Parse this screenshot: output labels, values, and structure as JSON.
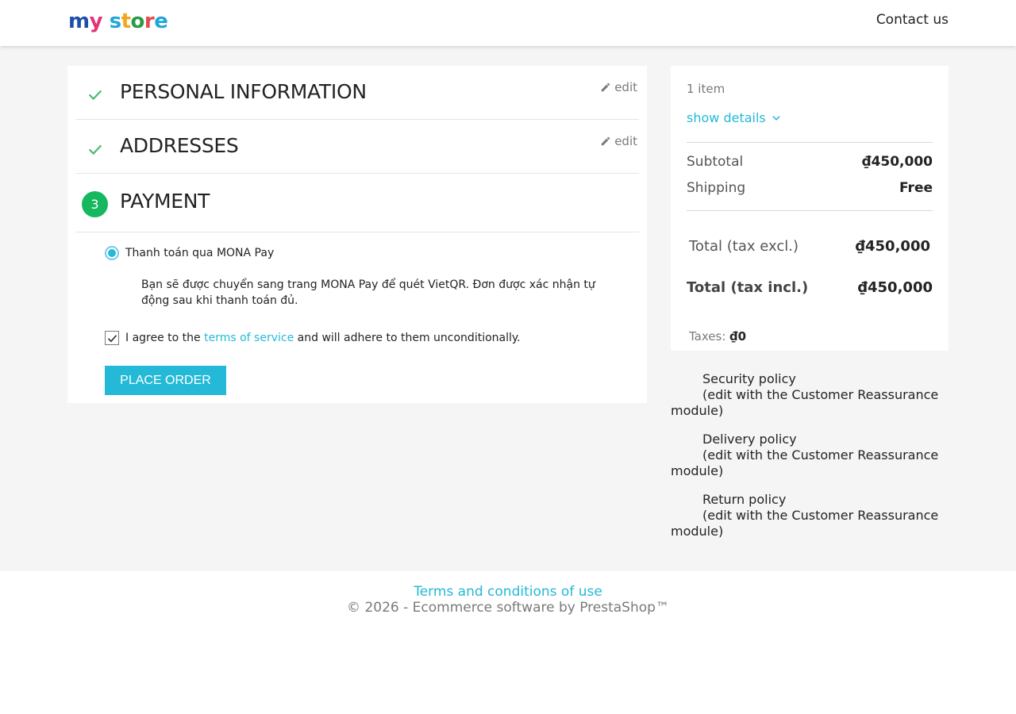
{
  "header": {
    "logo_parts": [
      "m",
      "y",
      " s",
      "t",
      "o",
      "r",
      "e"
    ],
    "contact_label": "Contact us"
  },
  "checkout": {
    "personal": {
      "title": "PERSONAL INFORMATION",
      "edit_label": "edit"
    },
    "addresses": {
      "title": "ADDRESSES",
      "edit_label": "edit"
    },
    "payment": {
      "step_number": "3",
      "title": "PAYMENT",
      "option_label": "Thanh toán qua MONA Pay",
      "option_description": "Bạn sẽ được chuyển sang trang MONA Pay để quét VietQR. Đơn được xác nhận tự động sau khi thanh toán đủ.",
      "agree_prefix": "I agree to the",
      "agree_link": "terms of service",
      "agree_suffix": "and will adhere to them unconditionally.",
      "place_order_label": "PLACE ORDER"
    }
  },
  "summary": {
    "items_count": "1 item",
    "show_details_label": "show details",
    "subtotal_label": "Subtotal",
    "subtotal_value": "₫450,000",
    "shipping_label": "Shipping",
    "shipping_value": "Free",
    "total_excl_label": "Total (tax excl.)",
    "total_excl_value": "₫450,000",
    "total_incl_label": "Total (tax incl.)",
    "total_incl_value": "₫450,000",
    "taxes_label": "Taxes:",
    "taxes_value": "₫0"
  },
  "reassurance": [
    {
      "title": "Security policy",
      "desc": "(edit with the Customer Reassurance module)"
    },
    {
      "title": "Delivery policy",
      "desc": "(edit with the Customer Reassurance module)"
    },
    {
      "title": "Return policy",
      "desc": "(edit with the Customer Reassurance module)"
    }
  ],
  "footer": {
    "terms_link": "Terms and conditions of use",
    "copyright": "© 2026 - Ecommerce software by PrestaShop™"
  },
  "colors": {
    "accent": "#24b9d7",
    "step_done": "#4cbb6c",
    "step_current": "#15b85f",
    "background": "#f5f5f5"
  }
}
